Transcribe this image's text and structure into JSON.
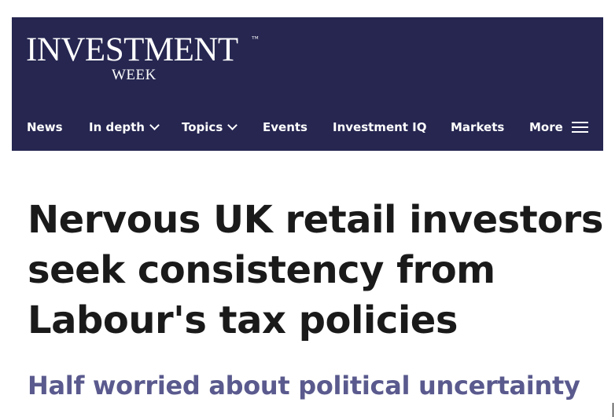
{
  "brand": {
    "name": "INVESTMENT",
    "trademark": "™",
    "sub": "WEEK"
  },
  "nav": {
    "items": [
      {
        "label": "News"
      },
      {
        "label": "In depth",
        "dropdown": true
      },
      {
        "label": "Topics",
        "dropdown": true
      },
      {
        "label": "Events"
      },
      {
        "label": "Investment IQ"
      },
      {
        "label": "Markets"
      },
      {
        "label": "More",
        "icon": "menu-icon"
      }
    ]
  },
  "article": {
    "headline": "Nervous UK retail investors seek consistency from Labour's tax policies",
    "standfirst": "Half worried about political uncertainty"
  },
  "colors": {
    "header_bg": "#262651",
    "headline": "#1a1a1a",
    "standfirst": "#5a5a8e"
  }
}
